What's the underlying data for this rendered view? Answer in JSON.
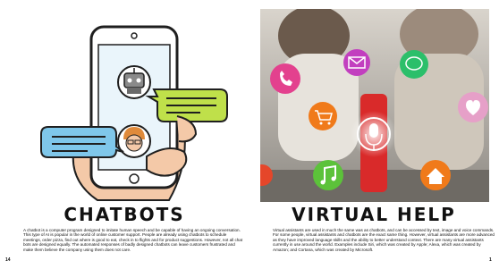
{
  "left_page": {
    "heading": "CHATBOTS",
    "body": "A chatbot is a computer program designed to imitate human speech and be capable of having an ongoing conversation. This type of AI is popular in the world of online customer support. People are already using chatbots to schedule meetings, order pizza, find out where is good to eat, check in to flights and for product suggestions. However, not all chat bots are designed equally. The automated responses of badly designed chatbots can leave customers frustrated and make them believe the company using them does not care.",
    "page_number": "14"
  },
  "right_page": {
    "heading": "VIRTUAL HELP",
    "body": "Virtual assistants are used in much the same was as chatbots, and can be accessed by text, image and voice commands. For some people, virtual assistants and chatbots are the exact same thing. However, virtual assistants are more advanced as they have improved language skills and the ability to better understand context. There are many virtual assistants currently in use around the world. Examples include Siri, which was created by Apple; Alexa, which was created by Amazon; and Cortana, which was created by Microsoft.",
    "page_number": "1"
  },
  "colors": {
    "phone_outline": "#1f1f1f",
    "skin": "#f4c9a8",
    "robot_bubble": "#bfe04a",
    "human_bubble": "#7fc7ea",
    "speaker_red": "#d92a2a",
    "photo_bg": "#b9b5ad"
  }
}
